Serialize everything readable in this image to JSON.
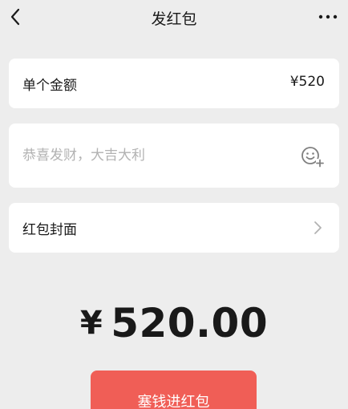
{
  "navbar": {
    "title": "发红包",
    "back_icon": "chevron-left-icon",
    "more_icon": "more-dots-icon"
  },
  "amount_row": {
    "label": "单个金额",
    "value": "¥520"
  },
  "message_row": {
    "placeholder": "恭喜发财，大吉大利",
    "value": "",
    "emoji_icon": "emoji-add-icon"
  },
  "cover_row": {
    "label": "红包封面",
    "chevron_icon": "chevron-right-icon"
  },
  "total": {
    "currency": "¥",
    "amount": "520.00"
  },
  "submit": {
    "label": "塞钱进红包"
  },
  "colors": {
    "background": "#ededed",
    "card": "#ffffff",
    "accent": "#f05e56",
    "placeholder": "#b2b2b2",
    "text": "#191919"
  }
}
